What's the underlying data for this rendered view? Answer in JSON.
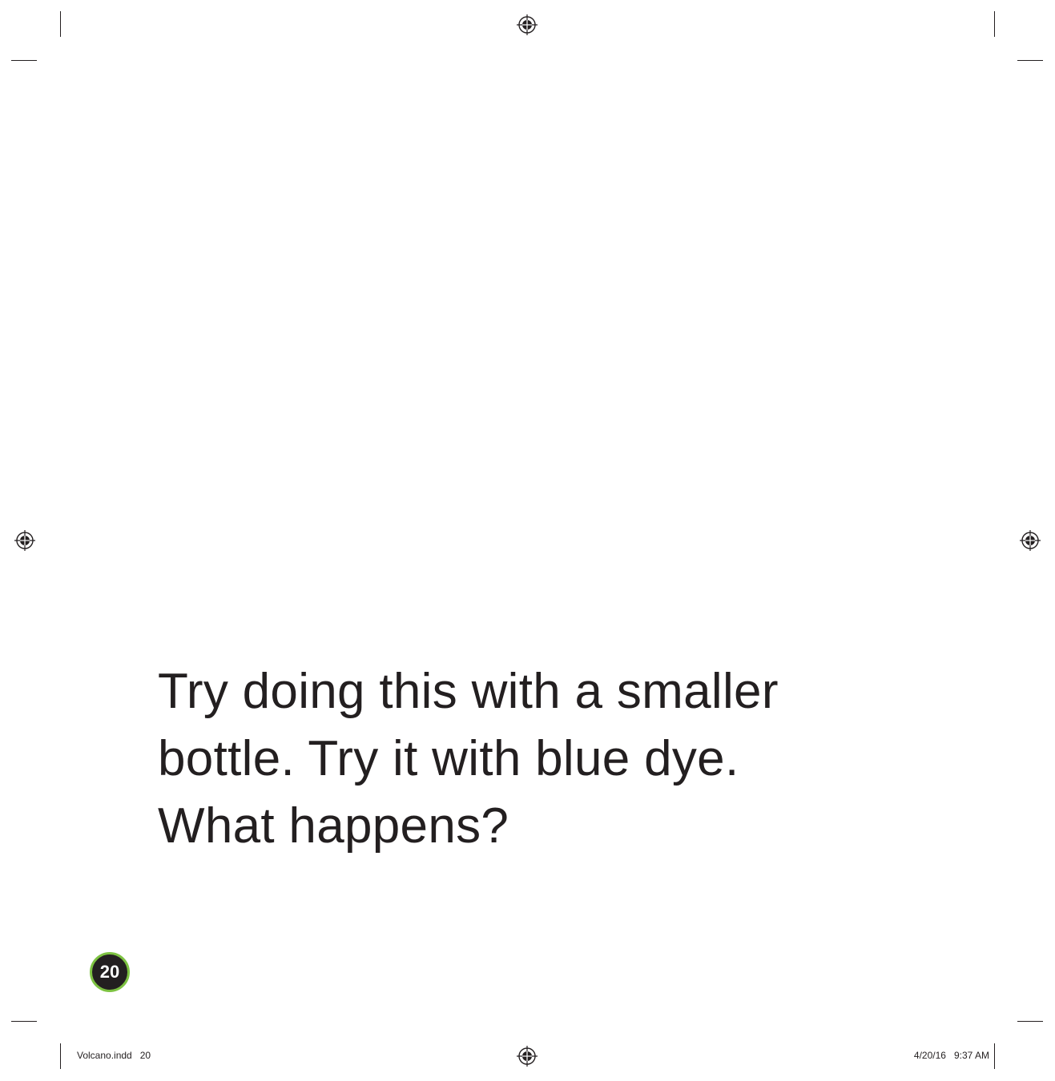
{
  "body_text": {
    "line1": "Try doing this with a smaller",
    "line2": "bottle. Try it with blue dye.",
    "line3": "What happens?"
  },
  "folio": {
    "page_number": "20"
  },
  "slug": {
    "left": "Volcano.indd   20",
    "right": "4/20/16   9:37 AM"
  },
  "colors": {
    "text": "#231f20",
    "folio_ring": "#7dc242",
    "folio_fill": "#231f20"
  },
  "icons": {
    "registration_mark": "registration-mark-icon"
  }
}
